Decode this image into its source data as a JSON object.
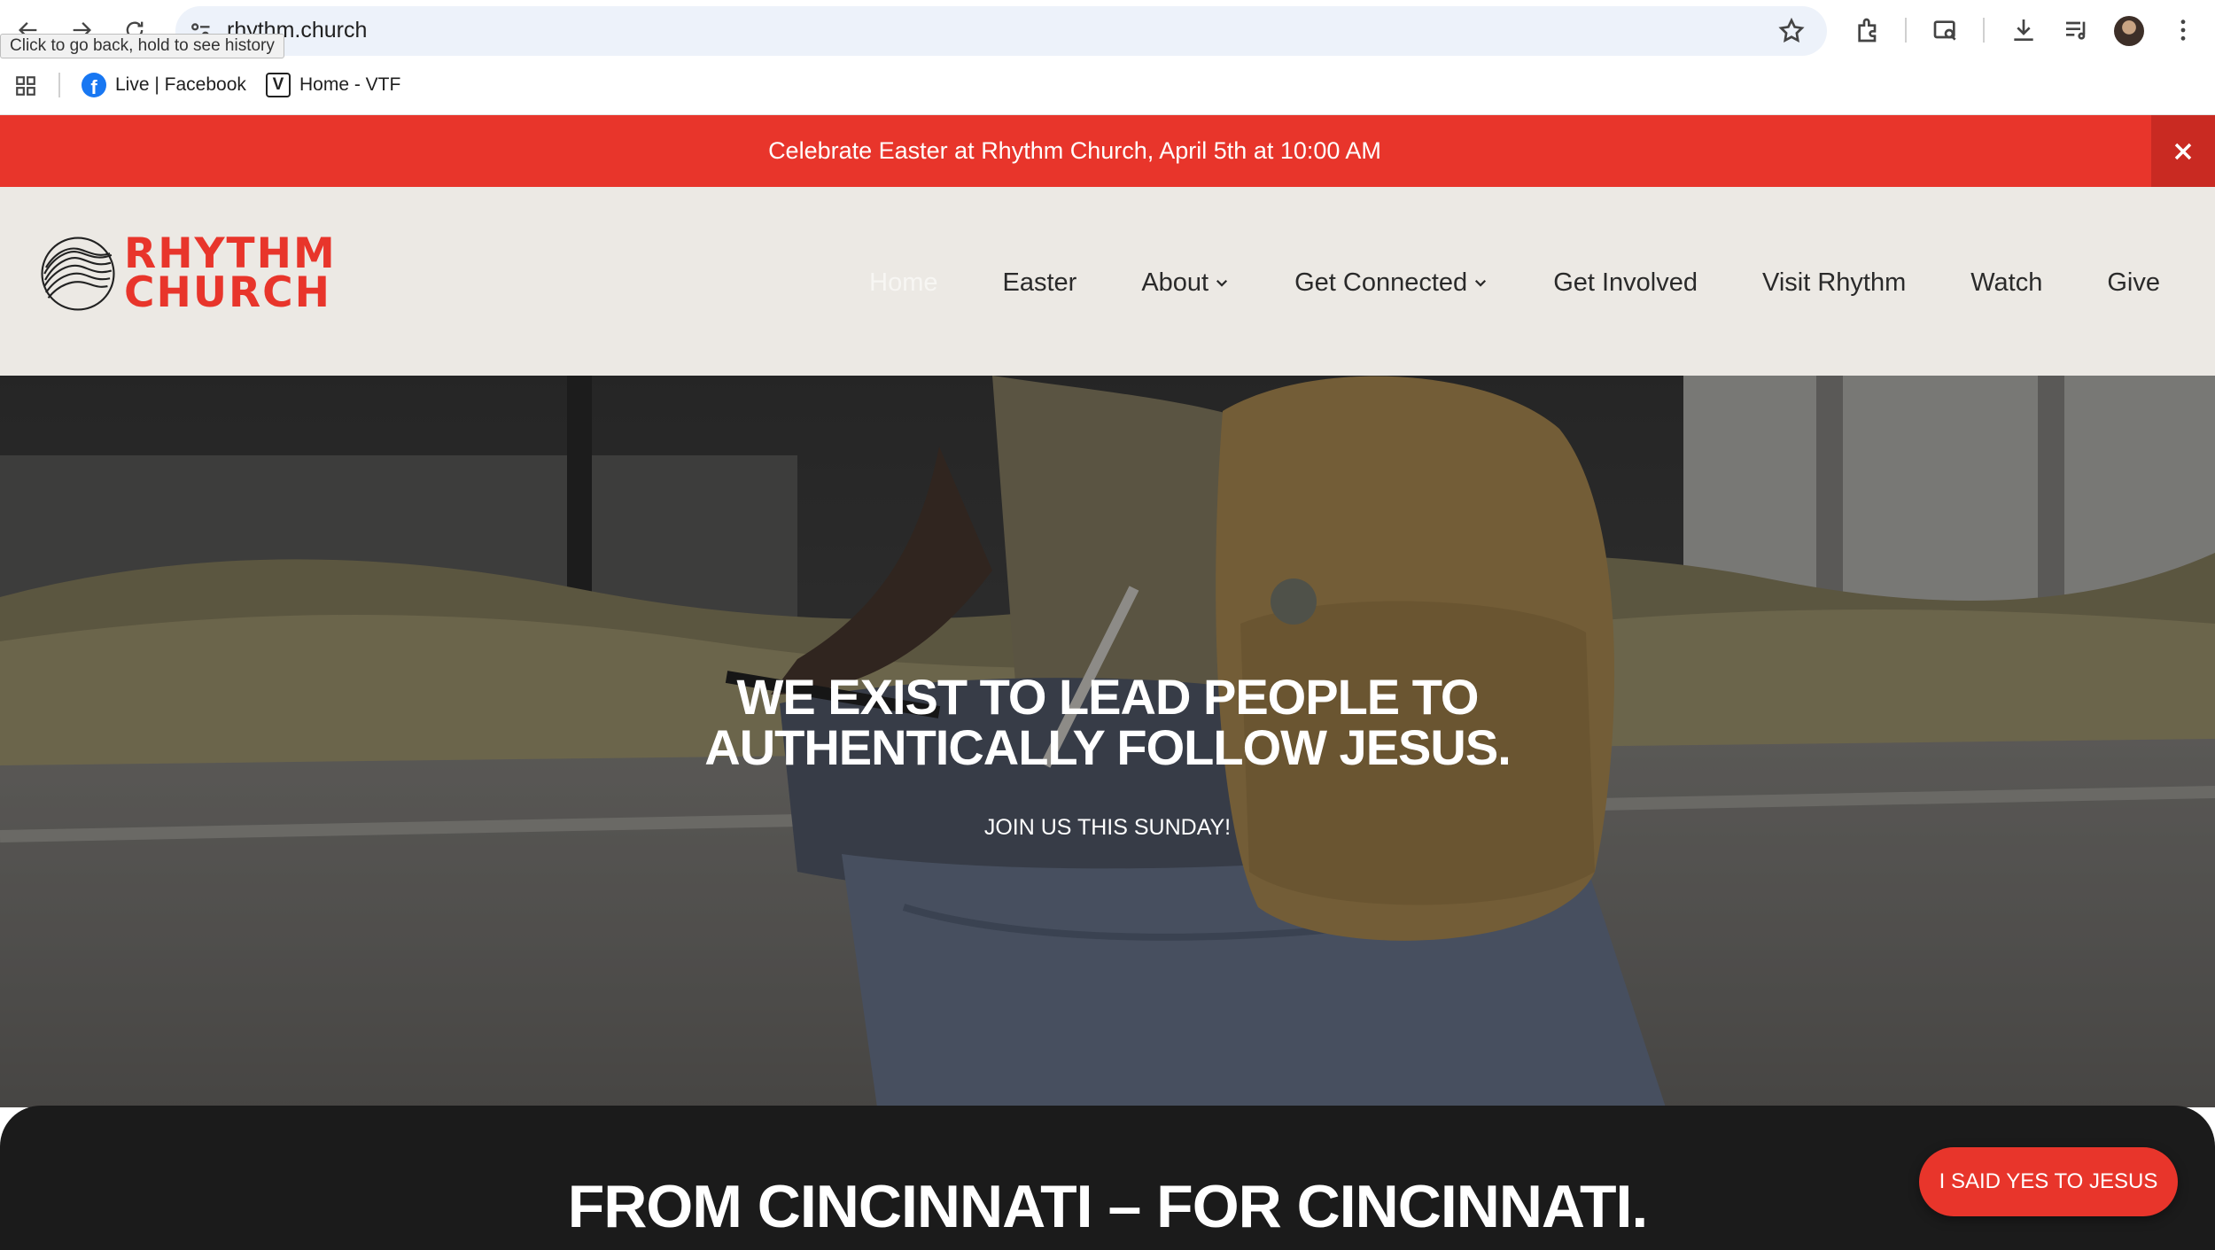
{
  "browser": {
    "url": "rhythm.church",
    "back_tooltip": "Click to go back, hold to see history",
    "bookmarks": [
      {
        "label": "Live | Facebook",
        "icon": "facebook-icon"
      },
      {
        "label": "Home - VTF",
        "icon": "vtf-icon"
      }
    ]
  },
  "banner": {
    "text": "Celebrate Easter at Rhythm Church, April 5th at 10:00 AM",
    "close_label": "×"
  },
  "site": {
    "logo_line1": "RHYTHM",
    "logo_line2": "CHURCH",
    "nav": [
      {
        "label": "Home",
        "active": true
      },
      {
        "label": "Easter"
      },
      {
        "label": "About",
        "dropdown": true
      },
      {
        "label": "Get Connected",
        "dropdown": true
      },
      {
        "label": "Get Involved"
      },
      {
        "label": "Visit Rhythm"
      },
      {
        "label": "Watch"
      },
      {
        "label": "Give"
      }
    ]
  },
  "hero": {
    "title_line1": "WE EXIST TO LEAD PEOPLE TO",
    "title_line2": "AUTHENTICALLY FOLLOW JESUS.",
    "subtitle": "JOIN US THIS SUNDAY!"
  },
  "section": {
    "title": "FROM CINCINNATI – FOR CINCINNATI."
  },
  "cta": {
    "label": "I SAID YES TO JESUS"
  },
  "colors": {
    "brand_red": "#e8352b",
    "header_bg": "#ece9e4",
    "dark_bg": "#1b1b1b"
  }
}
